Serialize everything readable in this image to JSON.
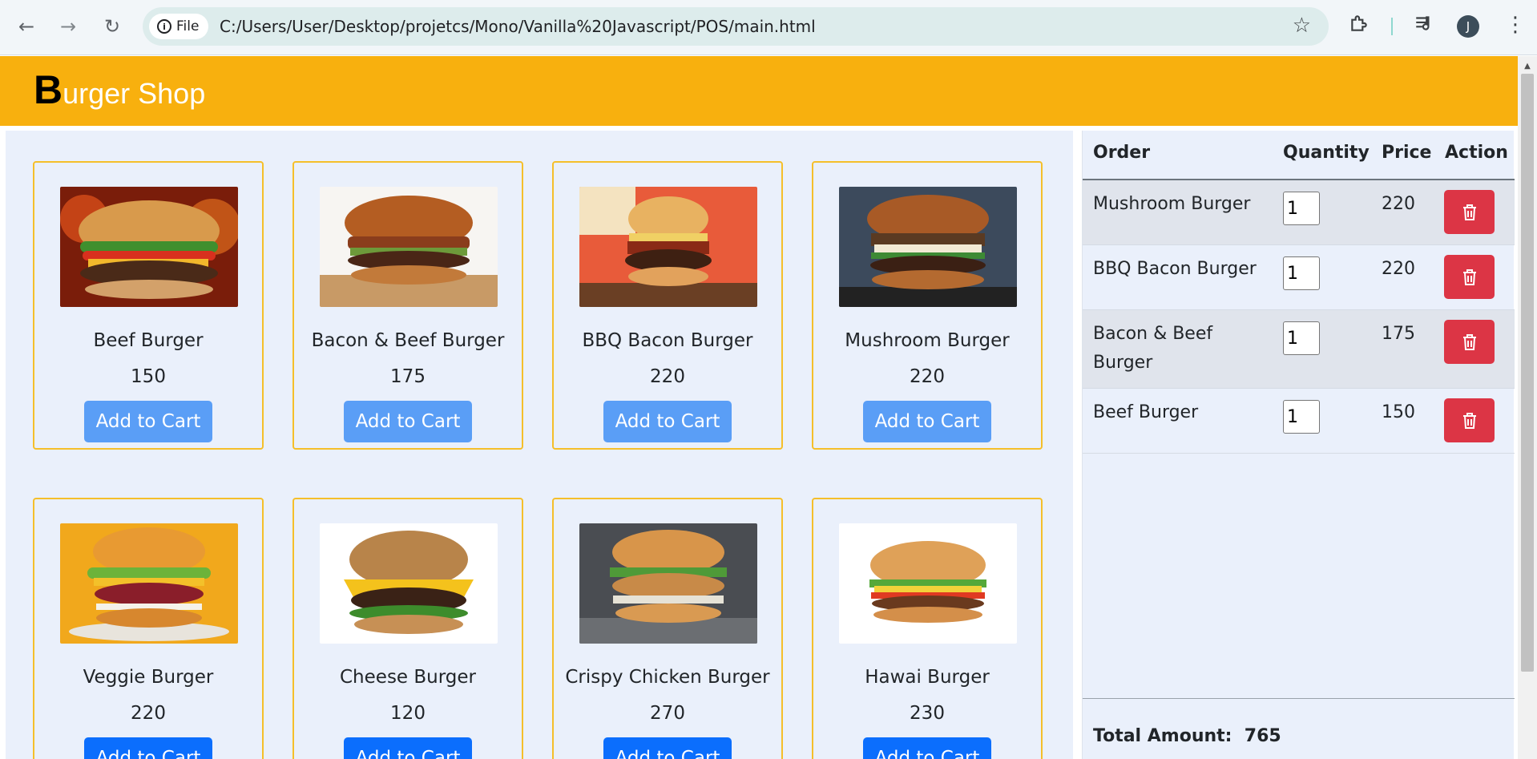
{
  "browser": {
    "site_chip": "File",
    "url": "C:/Users/User/Desktop/projetcs/Mono/Vanilla%20Javascript/POS/main.html",
    "avatar_initial": "J",
    "icons": [
      "back-icon",
      "forward-icon",
      "reload-icon",
      "info-icon",
      "star-icon",
      "extensions-icon",
      "media-icon",
      "menu-icon"
    ]
  },
  "header": {
    "brand_first": "B",
    "brand_rest": "urger Shop",
    "color": "#f8b00e"
  },
  "menu": {
    "add_label": "Add to Cart",
    "items": [
      {
        "name": "Beef Burger",
        "price": "150"
      },
      {
        "name": "Bacon & Beef Burger",
        "price": "175"
      },
      {
        "name": "BBQ Bacon Burger",
        "price": "220"
      },
      {
        "name": "Mushroom Burger",
        "price": "220"
      },
      {
        "name": "Veggie Burger",
        "price": "220"
      },
      {
        "name": "Cheese Burger",
        "price": "120"
      },
      {
        "name": "Crispy Chicken Burger",
        "price": "270"
      },
      {
        "name": "Hawai Burger",
        "price": "230"
      }
    ]
  },
  "order": {
    "headers": {
      "order": "Order",
      "quantity": "Quantity",
      "price": "Price",
      "action": "Action"
    },
    "rows": [
      {
        "name": "Mushroom Burger",
        "qty": "1",
        "price": "220"
      },
      {
        "name": "BBQ Bacon Burger",
        "qty": "1",
        "price": "220"
      },
      {
        "name": "Bacon & Beef Burger",
        "qty": "1",
        "price": "175"
      },
      {
        "name": "Beef Burger",
        "qty": "1",
        "price": "150"
      }
    ],
    "total_label": "Total Amount:",
    "total_value": "765",
    "delete_color": "#dc3545"
  }
}
